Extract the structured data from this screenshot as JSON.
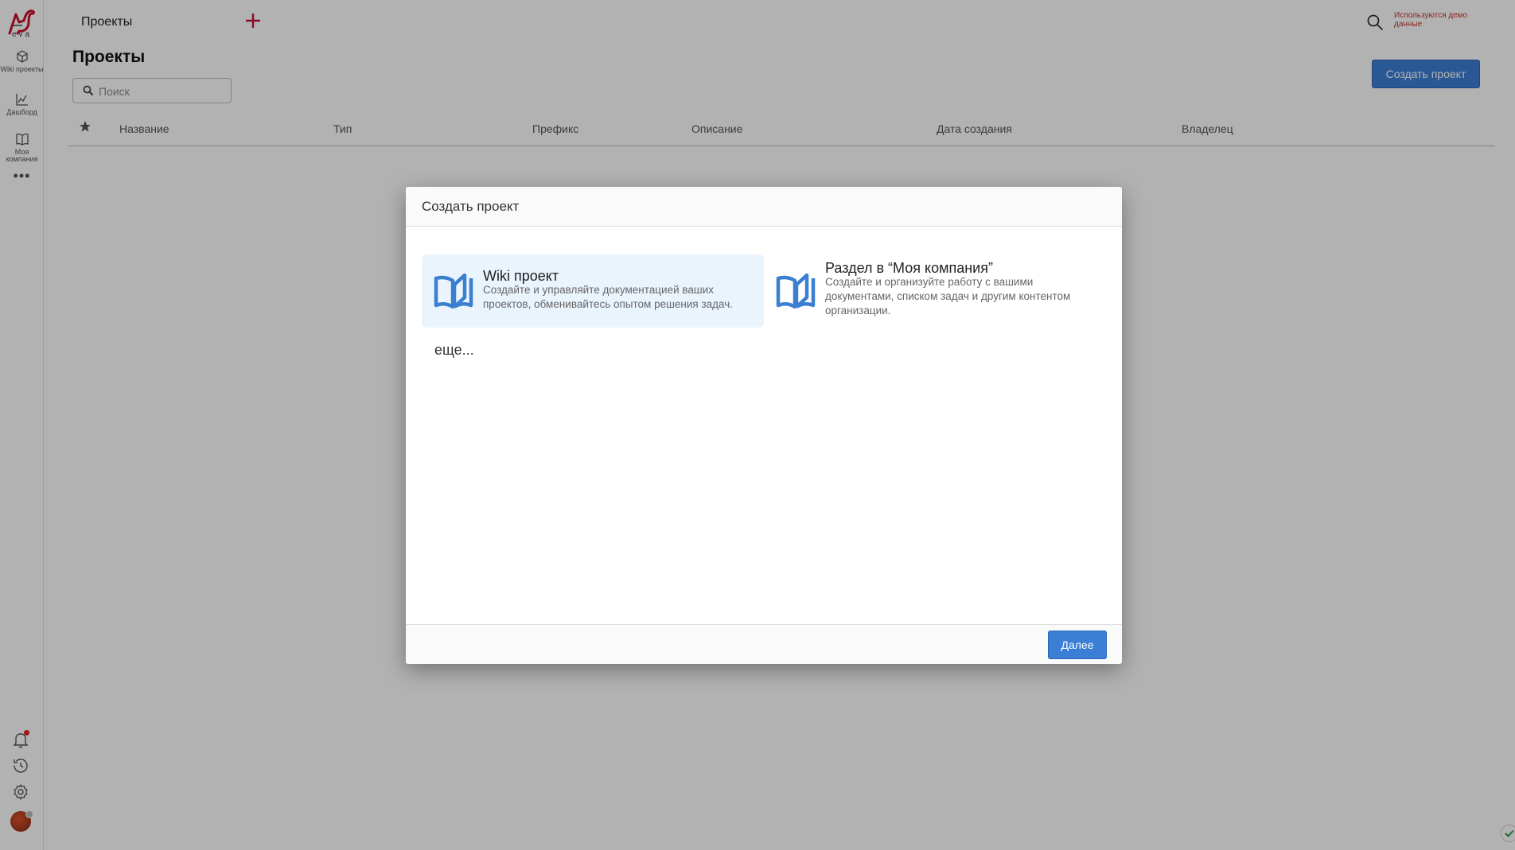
{
  "sidebar": {
    "logo_text": "eva",
    "items": [
      {
        "label": "Wiki проекты",
        "icon": "cube-icon"
      },
      {
        "label": "Дашборд",
        "icon": "chart-icon"
      },
      {
        "label": "Моя компания",
        "icon": "book-icon"
      }
    ],
    "more": "•••",
    "bottom_icons": [
      "bell-icon",
      "history-icon",
      "gear-icon",
      "avatar"
    ]
  },
  "topbar": {
    "title": "Проекты",
    "demo_notice": "Используются демо данные"
  },
  "page": {
    "title": "Проекты",
    "search_placeholder": "Поиск",
    "create_button": "Создать проект",
    "columns": [
      "Название",
      "Тип",
      "Префикс",
      "Описание",
      "Дата создания",
      "Владелец"
    ]
  },
  "modal": {
    "title": "Создать проект",
    "options": [
      {
        "title": "Wiki проект",
        "description": "Создайте и управляйте документацией ваших проектов, обменивайтесь опытом решения задач.",
        "selected": true
      },
      {
        "title": "Раздел в “Моя компания”",
        "description": "Создайте и организуйте работу с вашими документами, списком задач и другим контентом организации.",
        "selected": false
      }
    ],
    "more_link": "еще...",
    "next_button": "Далее"
  },
  "colors": {
    "accent": "#3b7ed6",
    "brand_red": "#c8102e",
    "icon_blue": "#3a7fd0",
    "selected_option_bg": "#eaf4fd"
  }
}
